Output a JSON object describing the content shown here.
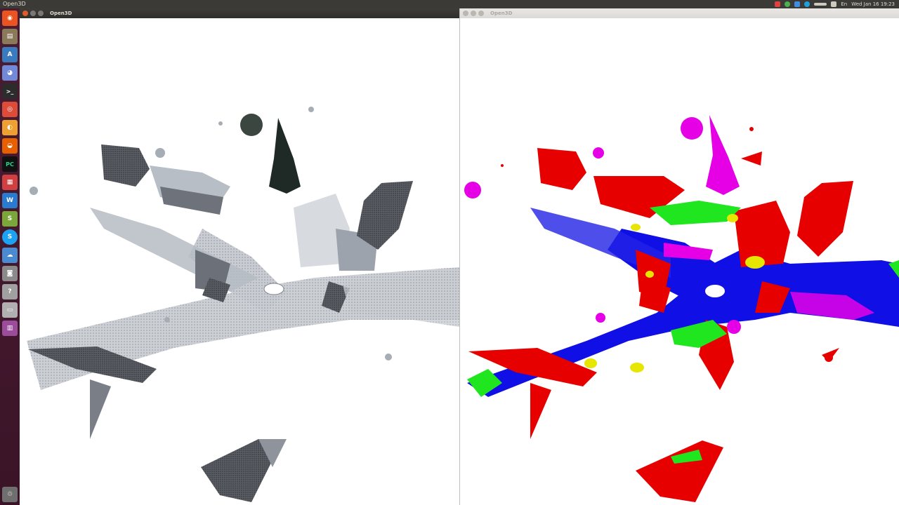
{
  "top_panel": {
    "app_title": "Open3D",
    "indicators": [
      {
        "icon": "record-icon",
        "color": "#e04040"
      },
      {
        "icon": "chrome-icon",
        "color": "#4caf50"
      },
      {
        "icon": "dropbox-icon",
        "color": "#3d8ee0"
      },
      {
        "icon": "skype-icon",
        "color": "#1ea0e0"
      },
      {
        "icon": "network-icon",
        "color": "#cfcac0"
      },
      {
        "icon": "battery-icon",
        "color": "#cfcac0"
      }
    ],
    "keyboard": "En",
    "clock": "Wed Jan 16  19:23"
  },
  "launcher": {
    "items": [
      {
        "name": "ubuntu-dash-icon",
        "glyph": "◉",
        "color": "#e95420"
      },
      {
        "name": "files-icon",
        "glyph": "▤",
        "color": "#8a7a5a"
      },
      {
        "name": "text-editor-icon",
        "glyph": "A",
        "color": "#3a7bbf"
      },
      {
        "name": "discord-icon",
        "glyph": "◕",
        "color": "#7289da"
      },
      {
        "name": "terminal-icon",
        "glyph": ">_",
        "color": "#2c2c2c"
      },
      {
        "name": "chrome-icon",
        "glyph": "◎",
        "color": "#dd4b39"
      },
      {
        "name": "screenshot-icon",
        "glyph": "◐",
        "color": "#f0a030"
      },
      {
        "name": "firefox-icon",
        "glyph": "◒",
        "color": "#e66000"
      },
      {
        "name": "pycharm-icon",
        "glyph": "PC",
        "color": "#21d789"
      },
      {
        "name": "clipboard-icon",
        "glyph": "▦",
        "color": "#d04040"
      },
      {
        "name": "vscode-icon",
        "glyph": "W",
        "color": "#2a7ad0"
      },
      {
        "name": "sheet-icon",
        "glyph": "S",
        "color": "#7aa63a"
      },
      {
        "name": "skype-icon",
        "glyph": "S",
        "color": "#1da1f2"
      },
      {
        "name": "cloud-icon",
        "glyph": "☁",
        "color": "#4a8ad0"
      },
      {
        "name": "camera-icon",
        "glyph": "◙",
        "color": "#8a8a8a"
      },
      {
        "name": "help-icon",
        "glyph": "?",
        "color": "#a0a0a0"
      },
      {
        "name": "drive-icon",
        "glyph": "▭",
        "color": "#b0b0b0"
      },
      {
        "name": "workspace-icon",
        "glyph": "▥",
        "color": "#9b4d9b"
      }
    ],
    "trash": {
      "name": "trash-icon",
      "glyph": "♲",
      "color": "#8a8a8a"
    }
  },
  "windows": {
    "left": {
      "title": "Open3D",
      "view": "rgb-point-cloud"
    },
    "right": {
      "title": "Open3D",
      "view": "semantic-labels"
    }
  },
  "colors": {
    "building": "#e60000",
    "road": "#1010e6",
    "vegetation": "#e600e6",
    "grass": "#20e620",
    "car": "#e6e600",
    "panel_bg": "#3b3a36",
    "launcher_bg": "#4a1d32"
  }
}
